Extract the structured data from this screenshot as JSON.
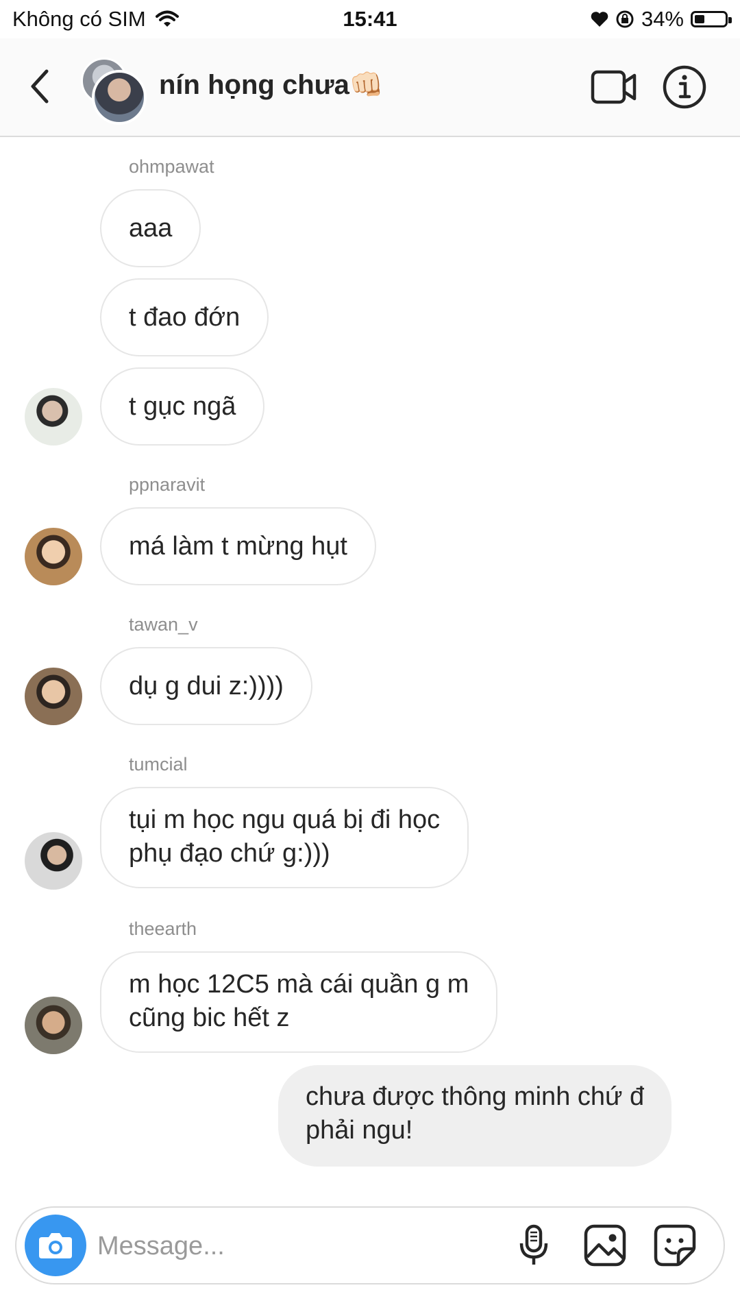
{
  "status_bar": {
    "carrier": "Không có SIM",
    "time": "15:41",
    "battery": "34%",
    "battery_level": 0.34
  },
  "header": {
    "title": "nín họng chưa👊🏻"
  },
  "messages": [
    {
      "sender": "ohmpawat",
      "text": "aaa"
    },
    {
      "text": "t đao đớn"
    },
    {
      "text": "t gục ngã"
    },
    {
      "sender": "ppnaravit",
      "text": "má làm t mừng hụt"
    },
    {
      "sender": "tawan_v",
      "text": "dụ g dui z:))))"
    },
    {
      "sender": "tumcial",
      "text": "tụi m học ngu quá bị đi học\nphụ đạo chứ g:)))"
    },
    {
      "sender": "theearth",
      "text": "m học 12C5 mà cái quần g m\ncũng bic hết z"
    },
    {
      "text": "chưa được thông minh chứ đ\nphải ngu!",
      "mine": true
    }
  ],
  "composer": {
    "placeholder": "Message..."
  },
  "colors": {
    "accent": "#3897f0",
    "bubble_border": "#e6e6e6",
    "own_bubble": "#efefef",
    "muted_text": "#8e8e8e"
  },
  "icons": [
    "wifi-icon",
    "heart-icon",
    "rotation-lock-icon",
    "battery-icon",
    "back-icon",
    "video-call-icon",
    "info-icon",
    "camera-icon",
    "microphone-icon",
    "gallery-icon",
    "sticker-icon"
  ]
}
